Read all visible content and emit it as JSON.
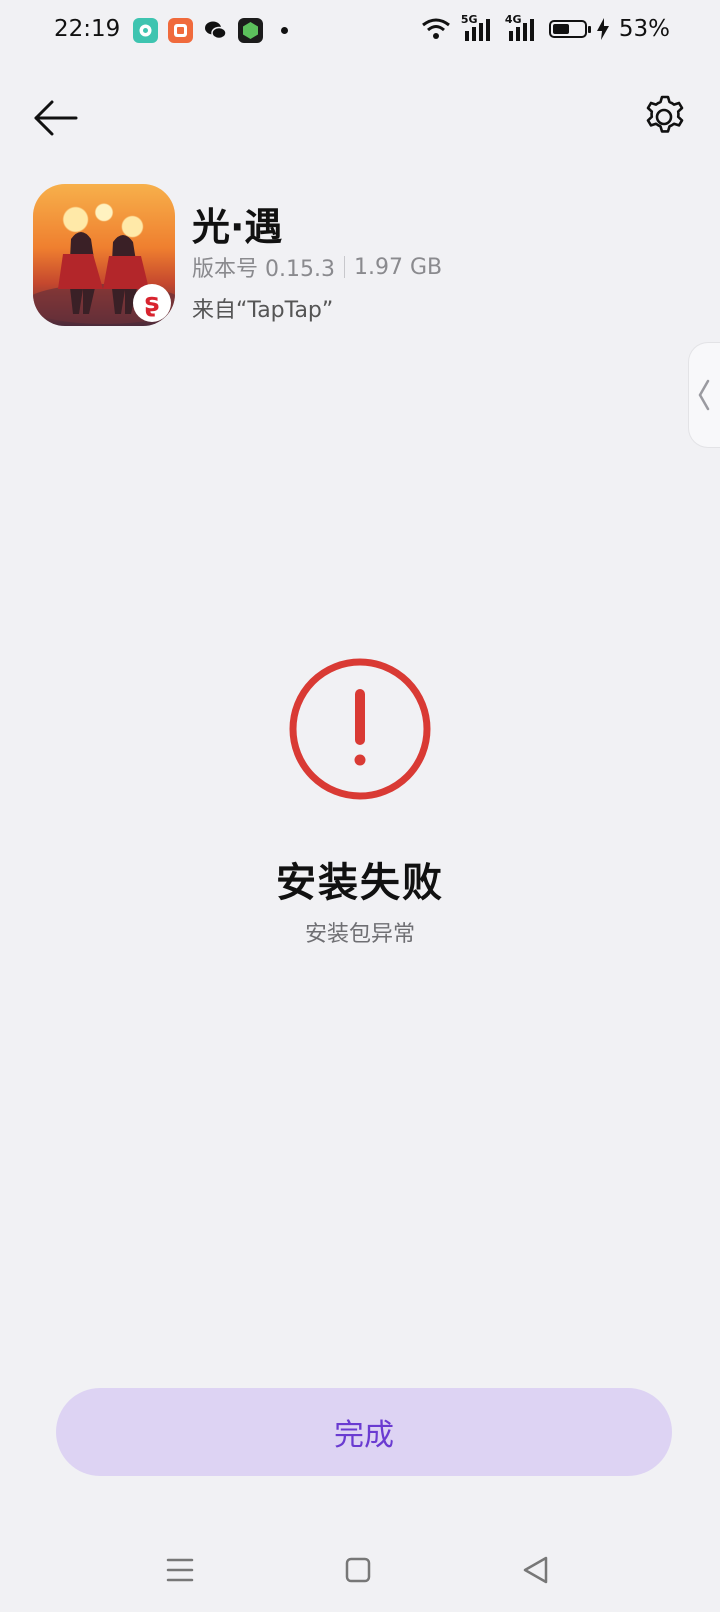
{
  "status_bar": {
    "time": "22:19",
    "battery_percent": "53%",
    "battery_level": 0.53,
    "network_5g": "5G",
    "network_4g": "4G",
    "notification_apps": [
      "message-app-icon",
      "shop-app-icon",
      "wechat-icon",
      "game-app-icon"
    ]
  },
  "app": {
    "name": "光·遇",
    "version": "版本号 0.15.3",
    "size": "1.97 GB",
    "source": "来自“TapTap”",
    "badge_icon": "netease-badge-icon"
  },
  "result": {
    "title": "安装失败",
    "subtitle": "安装包异常",
    "icon_color": "#d93a34"
  },
  "actions": {
    "done_label": "完成"
  },
  "colors": {
    "background": "#f1f1f4",
    "button_bg": "#ddd3f3",
    "button_text": "#6a3bd1"
  }
}
